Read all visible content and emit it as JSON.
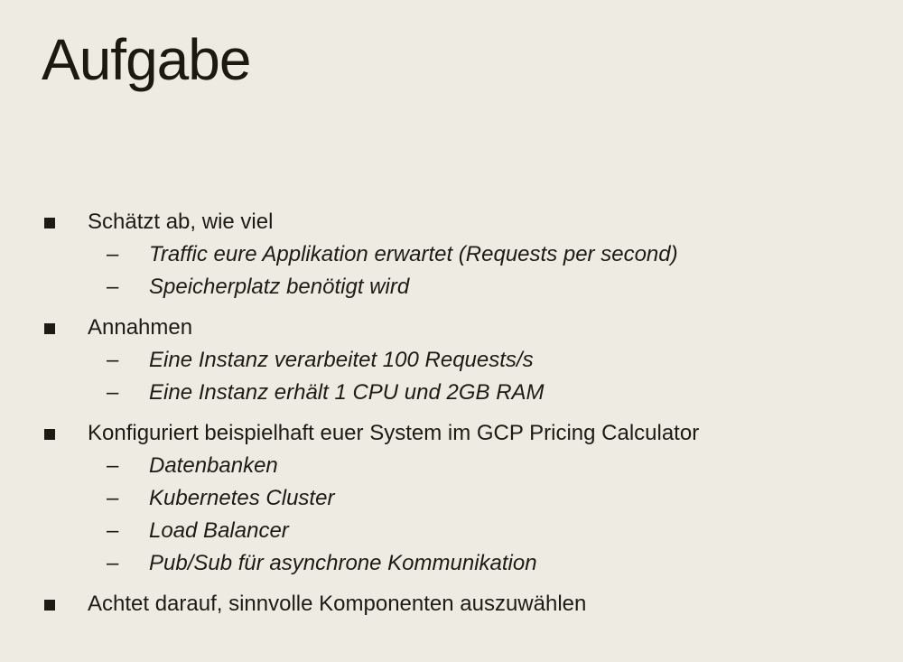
{
  "slide": {
    "title": "Aufgabe",
    "bullets": [
      {
        "text": "Schätzt ab, wie viel",
        "subitems": [
          "Traffic eure Applikation erwartet (Requests per second)",
          "Speicherplatz benötigt wird"
        ]
      },
      {
        "text": "Annahmen",
        "subitems": [
          "Eine Instanz verarbeitet 100 Requests/s",
          "Eine Instanz erhält 1 CPU und 2GB RAM"
        ]
      },
      {
        "text": "Konfiguriert beispielhaft euer System im GCP Pricing Calculator",
        "subitems": [
          "Datenbanken",
          "Kubernetes Cluster",
          "Load Balancer",
          "Pub/Sub für asynchrone Kommunikation"
        ]
      },
      {
        "text": "Achtet darauf, sinnvolle Komponenten auszuwählen",
        "subitems": []
      }
    ],
    "dash_glyph": "–"
  }
}
